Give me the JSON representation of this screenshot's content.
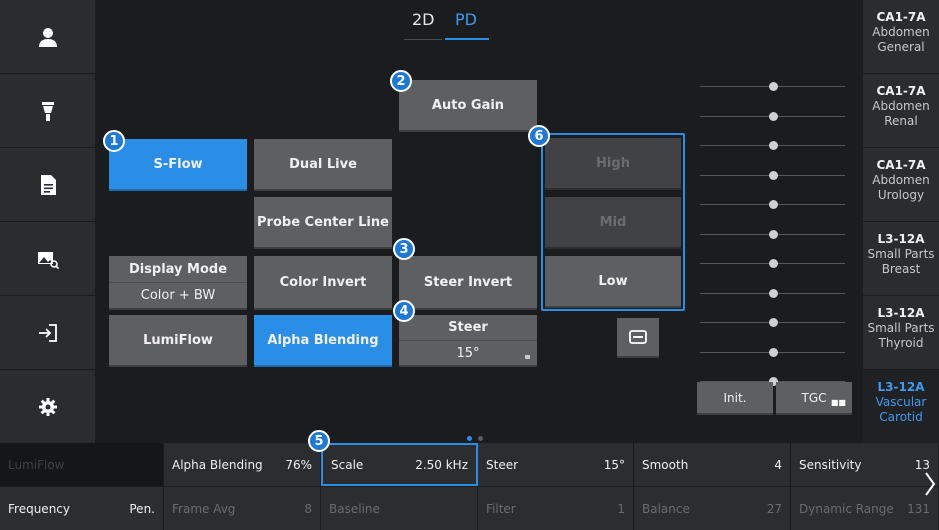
{
  "tabs": {
    "t2d": "2D",
    "tpd": "PD"
  },
  "colors": {
    "accent": "#2b8ee6",
    "panel": "#5d5f62",
    "background": "#1b1c1e"
  },
  "sidebar": [
    "person-icon",
    "probe-icon",
    "report-icon",
    "image-search-icon",
    "exit-icon",
    "settings-icon"
  ],
  "markers": {
    "m1": "1",
    "m2": "2",
    "m3": "3",
    "m4": "4",
    "m5": "5",
    "m6": "6"
  },
  "buttons": {
    "sflow": "S-Flow",
    "dual_live": "Dual Live",
    "auto_gain": "Auto Gain",
    "probe_center_line": "Probe Center Line",
    "display_mode_label": "Display Mode",
    "display_mode_value": "Color + BW",
    "color_invert": "Color Invert",
    "steer_invert": "Steer Invert",
    "lumiflow": "LumiFlow",
    "alpha_blending": "Alpha Blending",
    "steer_label": "Steer",
    "steer_value": "15°",
    "high": "High",
    "mid": "Mid",
    "low": "Low",
    "init": "Init.",
    "tgc": "TGC"
  },
  "tgc_levels": [
    0.5,
    0.5,
    0.5,
    0.5,
    0.5,
    0.5,
    0.5,
    0.5,
    0.5,
    0.5,
    0.5
  ],
  "presets": [
    {
      "model": "CA1-7A",
      "l1": "Abdomen",
      "l2": "General"
    },
    {
      "model": "CA1-7A",
      "l1": "Abdomen",
      "l2": "Renal"
    },
    {
      "model": "CA1-7A",
      "l1": "Abdomen",
      "l2": "Urology"
    },
    {
      "model": "L3-12A",
      "l1": "Small Parts",
      "l2": "Breast"
    },
    {
      "model": "L3-12A",
      "l1": "Small Parts",
      "l2": "Thyroid"
    },
    {
      "model": "L3-12A",
      "l1": "Vascular",
      "l2": "Carotid"
    }
  ],
  "params": {
    "row1": [
      {
        "label": "LumiFlow",
        "value": ""
      },
      {
        "label": "Alpha Blending",
        "value": "76%"
      },
      {
        "label": "Scale",
        "value": "2.50 kHz"
      },
      {
        "label": "Steer",
        "value": "15°"
      },
      {
        "label": "Smooth",
        "value": "4"
      },
      {
        "label": "Sensitivity",
        "value": "13"
      }
    ],
    "row2": [
      {
        "label": "Frequency",
        "value": "Pen."
      },
      {
        "label": "Frame Avg",
        "value": "8"
      },
      {
        "label": "Baseline",
        "value": ""
      },
      {
        "label": "Filter",
        "value": "1"
      },
      {
        "label": "Balance",
        "value": "27"
      },
      {
        "label": "Dynamic Range",
        "value": "131"
      }
    ]
  }
}
